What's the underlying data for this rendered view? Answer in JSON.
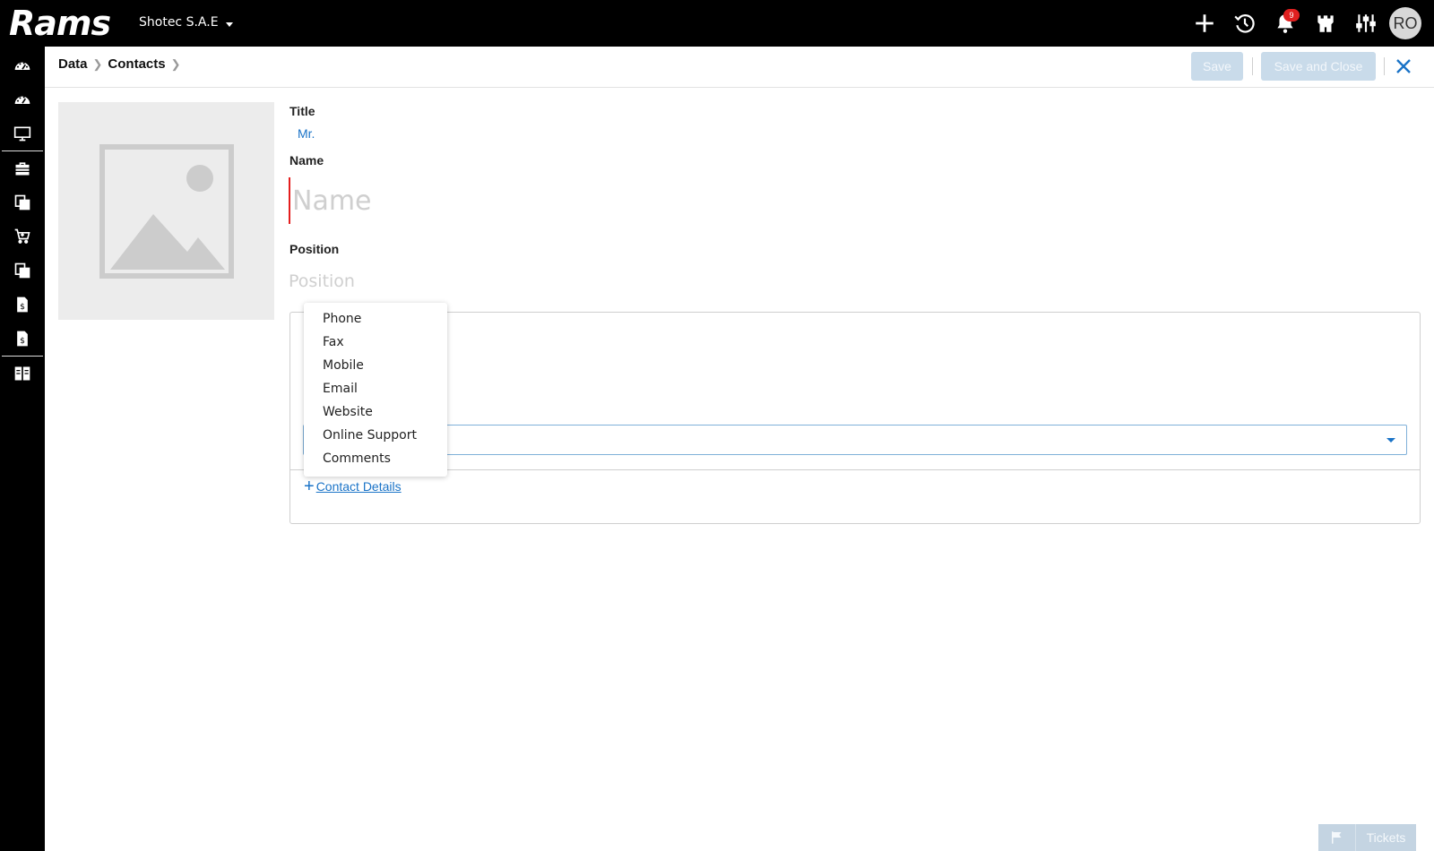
{
  "app": {
    "logo_text": "Rams",
    "company": "Shotec S.A.E"
  },
  "topbar": {
    "icons": [
      "add-icon",
      "history-icon",
      "bell-icon",
      "castle-icon",
      "sliders-icon"
    ],
    "notification_count": "9",
    "avatar_initials": "RO"
  },
  "sidebar": {
    "icons": [
      "dashboard-icon",
      "dashboard-icon",
      "monitor-icon",
      "briefcase-icon",
      "documents-icon",
      "cart-icon",
      "documents-icon",
      "invoice-icon",
      "invoice-icon",
      "grid-icon"
    ]
  },
  "breadcrumb": {
    "items": [
      "Data",
      "Contacts"
    ]
  },
  "toolbar": {
    "save_label": "Save",
    "save_close_label": "Save and Close"
  },
  "form": {
    "title_label": "Title",
    "title_value": "Mr.",
    "name_label": "Name",
    "name_placeholder": "Name",
    "position_label": "Position",
    "position_placeholder": "Position"
  },
  "contact_details": {
    "add_label": "Contact Details",
    "dropdown_options": [
      "Phone",
      "Fax",
      "Mobile",
      "Email",
      "Website",
      "Online Support",
      "Comments"
    ]
  },
  "footer": {
    "tickets_label": "Tickets"
  },
  "colors": {
    "topbar": "#000000",
    "accent": "#1a73c7",
    "required_marker": "#e41e1e",
    "badge": "#e02020",
    "disabled_button": "#c9dbea"
  }
}
